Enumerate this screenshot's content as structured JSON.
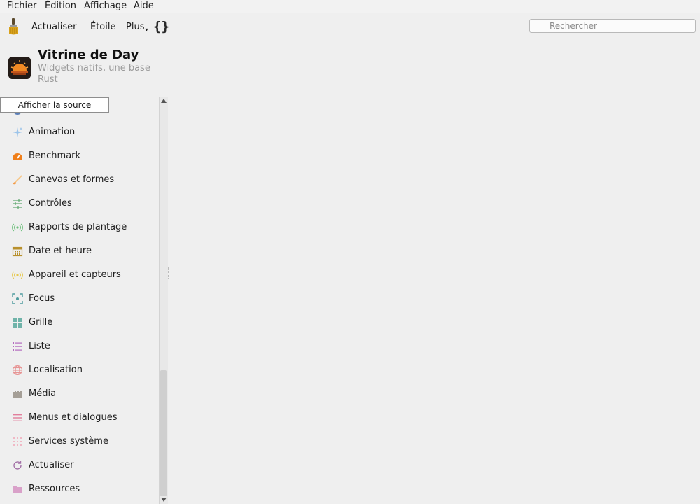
{
  "menu": [
    "Fichier",
    "Édition",
    "Affichage",
    "Aide"
  ],
  "toolbar": {
    "refresh_label": "Actualiser",
    "star_label": "Étoile",
    "more_label": "Plus",
    "braces_label": "{}",
    "search_placeholder": "Rechercher"
  },
  "app": {
    "title": "Vitrine de Day",
    "subtitle": "Widgets natifs, une base Rust"
  },
  "tooltip": "Afficher la source",
  "sidebar": {
    "items": [
      {
        "label": "Animation",
        "icon": "sparkle-icon"
      },
      {
        "label": "Benchmark",
        "icon": "gauge-icon"
      },
      {
        "label": "Canevas et formes",
        "icon": "brush-icon"
      },
      {
        "label": "Contrôles",
        "icon": "sliders-icon"
      },
      {
        "label": "Rapports de plantage",
        "icon": "broadcast-icon"
      },
      {
        "label": "Date et heure",
        "icon": "calendar-icon"
      },
      {
        "label": "Appareil et capteurs",
        "icon": "sensor-icon"
      },
      {
        "label": "Focus",
        "icon": "focus-icon"
      },
      {
        "label": "Grille",
        "icon": "grid-icon"
      },
      {
        "label": "Liste",
        "icon": "list-icon"
      },
      {
        "label": "Localisation",
        "icon": "globe-icon"
      },
      {
        "label": "Média",
        "icon": "film-icon"
      },
      {
        "label": "Menus et dialogues",
        "icon": "menu-icon"
      },
      {
        "label": "Services système",
        "icon": "dots-grid-icon"
      },
      {
        "label": "Actualiser",
        "icon": "refresh-icon"
      },
      {
        "label": "Ressources",
        "icon": "folder-icon"
      }
    ]
  },
  "colors": {
    "background": "#efefef",
    "logo_bg": "#231b17",
    "sun": "#f08a24"
  }
}
